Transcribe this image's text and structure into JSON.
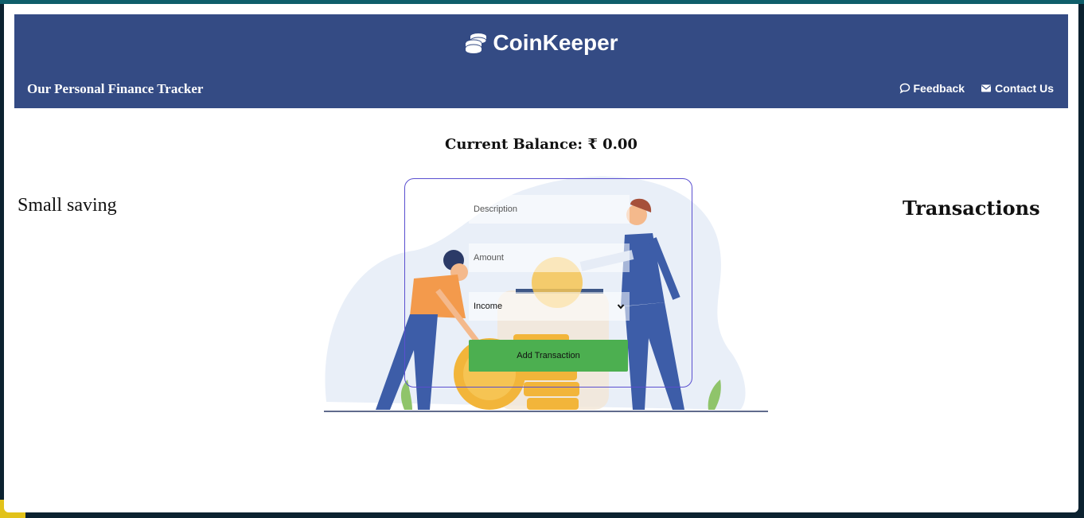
{
  "header": {
    "brand": "CoinKeeper",
    "tagline": "Our Personal Finance Tracker",
    "nav": [
      {
        "label": "Feedback",
        "icon": "chat-bubble-icon"
      },
      {
        "label": "Contact Us",
        "icon": "envelope-icon"
      }
    ]
  },
  "balance": {
    "text": "Current Balance: ₹ 0.00"
  },
  "left_section": {
    "title": "Small saving"
  },
  "right_section": {
    "title": "Transactions"
  },
  "form": {
    "description_placeholder": "Description",
    "amount_placeholder": "Amount",
    "type_selected": "Income",
    "submit_label": "Add Transaction"
  },
  "colors": {
    "header_bg": "#344b84",
    "button_bg": "#4caf50",
    "form_border": "#5a4fd0"
  }
}
